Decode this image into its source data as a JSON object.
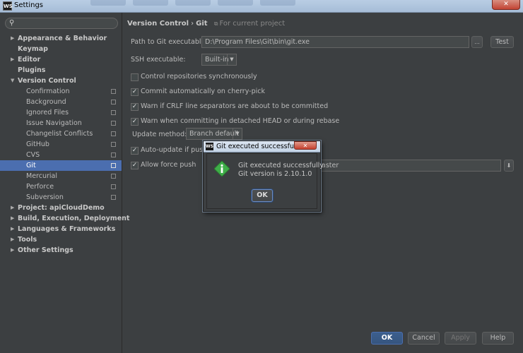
{
  "window": {
    "title": "Settings",
    "app_icon": "WS",
    "close_glyph": "✕"
  },
  "search": {
    "value": "",
    "placeholder": ""
  },
  "sidebar": {
    "items": [
      {
        "label": "Appearance & Behavior",
        "bold": true,
        "arrow": "right"
      },
      {
        "label": "Keymap",
        "bold": true
      },
      {
        "label": "Editor",
        "bold": true,
        "arrow": "right"
      },
      {
        "label": "Plugins",
        "bold": true
      },
      {
        "label": "Version Control",
        "bold": true,
        "arrow": "down"
      },
      {
        "label": "Confirmation",
        "child": true
      },
      {
        "label": "Background",
        "child": true
      },
      {
        "label": "Ignored Files",
        "child": true
      },
      {
        "label": "Issue Navigation",
        "child": true
      },
      {
        "label": "Changelist Conflicts",
        "child": true
      },
      {
        "label": "GitHub",
        "child": true
      },
      {
        "label": "CVS",
        "child": true
      },
      {
        "label": "Git",
        "child": true,
        "selected": true
      },
      {
        "label": "Mercurial",
        "child": true
      },
      {
        "label": "Perforce",
        "child": true
      },
      {
        "label": "Subversion",
        "child": true
      },
      {
        "label": "Project: apiCloudDemo",
        "bold": true,
        "arrow": "right"
      },
      {
        "label": "Build, Execution, Deployment",
        "bold": true,
        "arrow": "right"
      },
      {
        "label": "Languages & Frameworks",
        "bold": true,
        "arrow": "right"
      },
      {
        "label": "Tools",
        "bold": true,
        "arrow": "right"
      },
      {
        "label": "Other Settings",
        "bold": true,
        "arrow": "right"
      }
    ]
  },
  "breadcrumb": {
    "parent": "Version Control",
    "separator": "›",
    "current": "Git",
    "scope": "For current project"
  },
  "git": {
    "path_label": "Path to Git executable:",
    "path_value": "D:\\Program Files\\Git\\bin\\git.exe",
    "browse_label": "...",
    "test_label": "Test",
    "ssh_label": "SSH executable:",
    "ssh_value": "Built-in",
    "options": [
      {
        "label": "Control repositories synchronously",
        "checked": false
      },
      {
        "label": "Commit automatically on cherry-pick",
        "checked": true
      },
      {
        "label": "Warn if CRLF line separators are about to be committed",
        "checked": true
      },
      {
        "label": "Warn when committing in detached HEAD or during rebase",
        "checked": true
      }
    ],
    "update_method_label": "Update method:",
    "update_method_value": "Branch default",
    "auto_update_label": "Auto-update if push",
    "auto_update_checked": true,
    "force_push_label": "Allow force push",
    "force_push_checked": true,
    "protected_branch_value": "aster"
  },
  "footer": {
    "ok": "OK",
    "cancel": "Cancel",
    "apply": "Apply",
    "help": "Help"
  },
  "dialog": {
    "title": "Git executed successfully",
    "close_glyph": "✕",
    "line1": "Git executed successfully",
    "line2": "Git version is 2.10.1.0",
    "ok": "OK",
    "icon": "info-icon"
  },
  "colors": {
    "background": "#3c3f41",
    "selection": "#4b6eaf",
    "info_icon": "#3fae49"
  }
}
